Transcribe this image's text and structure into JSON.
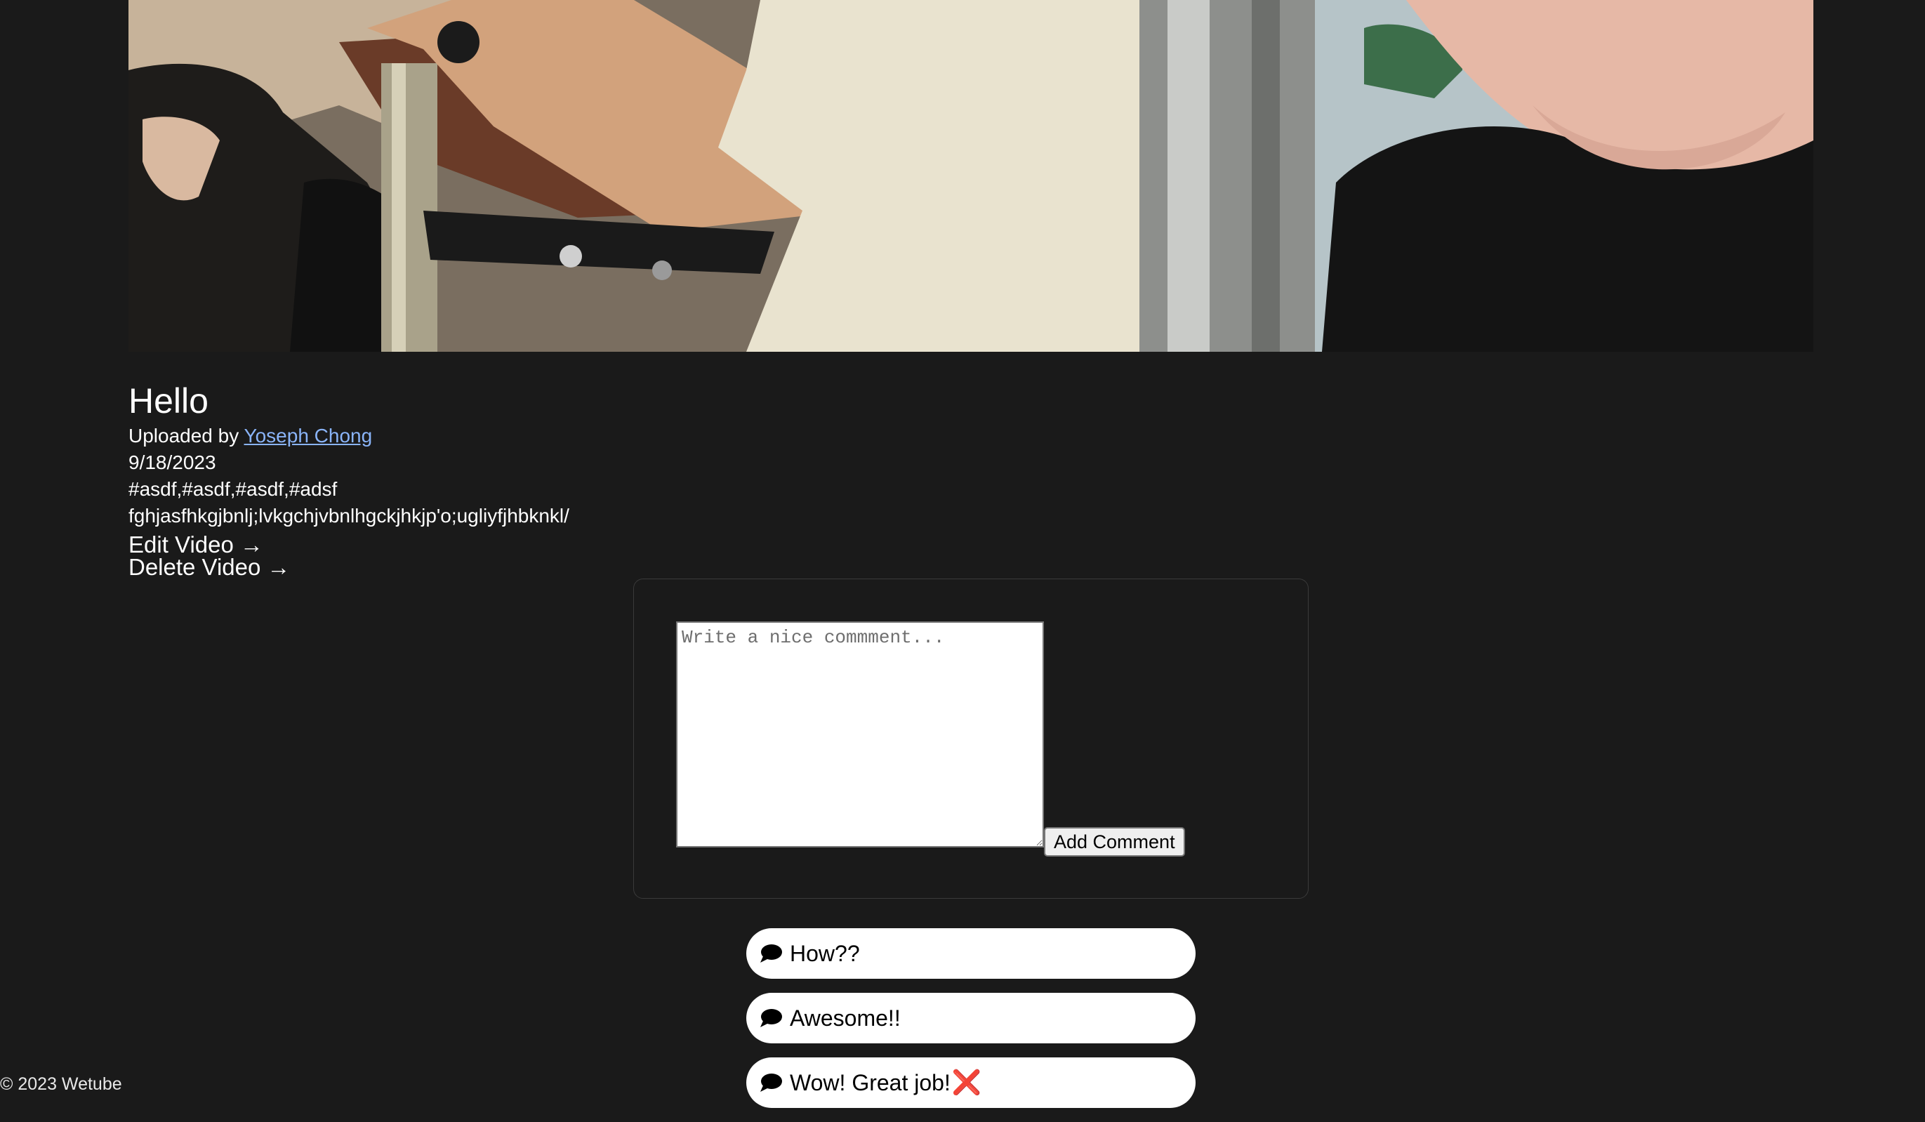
{
  "video": {
    "title": "Hello",
    "uploaded_by_prefix": "Uploaded by ",
    "uploader_name": "Yoseph Chong",
    "date": "9/18/2023",
    "hashtags": "#asdf,#asdf,#asdf,#adsf",
    "description": "fghjasfhkgjbnlj;lvkgchjvbnlhgckjhkjp'o;ugliyfjhbknkl/",
    "edit_label": "Edit Video →",
    "delete_label": "Delete Video →"
  },
  "comment_form": {
    "placeholder": "Write a nice commment...",
    "value": "",
    "submit_label": "Add Comment"
  },
  "comments": [
    {
      "icon": "comment-icon",
      "text": "How??"
    },
    {
      "icon": "comment-icon",
      "text": "Awesome!!"
    },
    {
      "icon": "comment-icon",
      "text": "Wow! Great job!",
      "delete": "❌"
    }
  ],
  "footer": {
    "text": "© 2023 Wetube"
  },
  "colors": {
    "background": "#1a1a1a",
    "link": "#8ab4f8",
    "comment_bg": "#ffffff",
    "delete_red": "#e0201c"
  }
}
